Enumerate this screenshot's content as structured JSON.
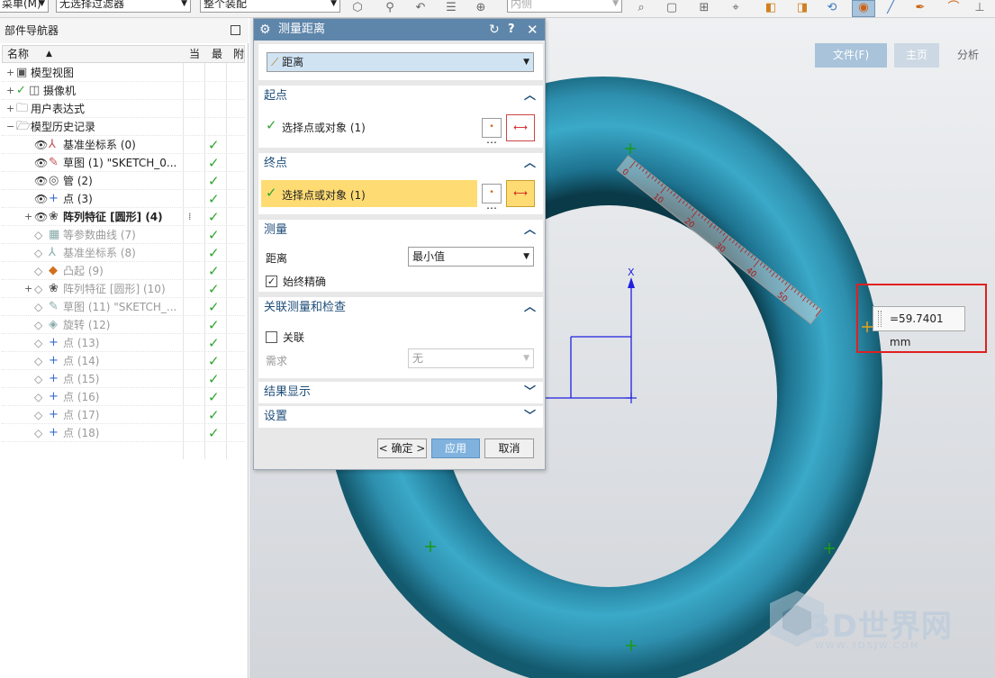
{
  "toolbar": {
    "menu_label": "菜单(M)",
    "filter_label": "无选择过滤器",
    "scope_label": "整个装配",
    "snap_label": "内侧"
  },
  "navigator": {
    "title": "部件导航器",
    "columns": {
      "name": "名称",
      "current": "当",
      "latest": "最",
      "attached": "附"
    },
    "rows": [
      {
        "label": "模型视图",
        "icon": "model-views-icon",
        "glyph": "▣",
        "expand": "+",
        "visible": false,
        "check": false,
        "dim": false,
        "bold": false,
        "indent": 0
      },
      {
        "label": "摄像机",
        "icon": "camera-icon",
        "glyph": "◫",
        "expand": "+",
        "visible": false,
        "check": false,
        "dim": false,
        "bold": false,
        "indent": 0,
        "greencheck": true
      },
      {
        "label": "用户表达式",
        "icon": "folder-icon",
        "glyph": "🗀",
        "expand": "+",
        "visible": false,
        "check": false,
        "dim": false,
        "bold": false,
        "indent": 0
      },
      {
        "label": "模型历史记录",
        "icon": "folder-open-icon",
        "glyph": "🗁",
        "expand": "−",
        "visible": false,
        "check": false,
        "dim": false,
        "bold": false,
        "indent": 0
      },
      {
        "label": "基准坐标系 (0)",
        "icon": "datum-csys-icon",
        "glyph": "⅄",
        "expand": "",
        "visible": true,
        "check": true,
        "dim": false,
        "bold": false,
        "indent": 1
      },
      {
        "label": "草图 (1) \"SKETCH_0...",
        "icon": "sketch-icon",
        "glyph": "✎",
        "expand": "",
        "visible": true,
        "check": true,
        "dim": false,
        "bold": false,
        "indent": 1
      },
      {
        "label": "管 (2)",
        "icon": "tube-icon",
        "glyph": "◎",
        "expand": "",
        "visible": true,
        "check": true,
        "dim": false,
        "bold": false,
        "indent": 1
      },
      {
        "label": "点 (3)",
        "icon": "point-icon",
        "glyph": "+",
        "expand": "",
        "visible": true,
        "check": true,
        "dim": false,
        "bold": false,
        "indent": 1
      },
      {
        "label": "阵列特征 [圆形] (4)",
        "icon": "pattern-feature-icon",
        "glyph": "❀",
        "expand": "+",
        "visible": true,
        "check": true,
        "dim": false,
        "bold": true,
        "indent": 1,
        "current": true
      },
      {
        "label": "等参数曲线 (7)",
        "icon": "iso-curve-icon",
        "glyph": "▦",
        "expand": "",
        "visible": false,
        "check": true,
        "dim": true,
        "bold": false,
        "indent": 1
      },
      {
        "label": "基准坐标系 (8)",
        "icon": "datum-csys-icon",
        "glyph": "⅄",
        "expand": "",
        "visible": false,
        "check": true,
        "dim": true,
        "bold": false,
        "indent": 1
      },
      {
        "label": "凸起 (9)",
        "icon": "emboss-icon",
        "glyph": "◆",
        "expand": "",
        "visible": false,
        "check": true,
        "dim": true,
        "bold": false,
        "indent": 1
      },
      {
        "label": "阵列特征 [圆形] (10)",
        "icon": "pattern-feature-icon",
        "glyph": "❀",
        "expand": "+",
        "visible": false,
        "check": true,
        "dim": true,
        "bold": false,
        "indent": 1
      },
      {
        "label": "草图 (11) \"SKETCH_...",
        "icon": "sketch-icon",
        "glyph": "✎",
        "expand": "",
        "visible": false,
        "check": true,
        "dim": true,
        "bold": false,
        "indent": 1
      },
      {
        "label": "旋转 (12)",
        "icon": "revolve-icon",
        "glyph": "◈",
        "expand": "",
        "visible": false,
        "check": true,
        "dim": true,
        "bold": false,
        "indent": 1
      },
      {
        "label": "点 (13)",
        "icon": "point-icon",
        "glyph": "+",
        "expand": "",
        "visible": false,
        "check": true,
        "dim": true,
        "bold": false,
        "indent": 1
      },
      {
        "label": "点 (14)",
        "icon": "point-icon",
        "glyph": "+",
        "expand": "",
        "visible": false,
        "check": true,
        "dim": true,
        "bold": false,
        "indent": 1
      },
      {
        "label": "点 (15)",
        "icon": "point-icon",
        "glyph": "+",
        "expand": "",
        "visible": false,
        "check": true,
        "dim": true,
        "bold": false,
        "indent": 1
      },
      {
        "label": "点 (16)",
        "icon": "point-icon",
        "glyph": "+",
        "expand": "",
        "visible": false,
        "check": true,
        "dim": true,
        "bold": false,
        "indent": 1
      },
      {
        "label": "点 (17)",
        "icon": "point-icon",
        "glyph": "+",
        "expand": "",
        "visible": false,
        "check": true,
        "dim": true,
        "bold": false,
        "indent": 1
      },
      {
        "label": "点 (18)",
        "icon": "point-icon",
        "glyph": "+",
        "expand": "",
        "visible": false,
        "check": true,
        "dim": true,
        "bold": false,
        "indent": 1
      }
    ]
  },
  "dialog": {
    "title": "测量距离",
    "type_value": "距离",
    "start": {
      "header": "起点",
      "select_label": "选择点或对象 (1)"
    },
    "end": {
      "header": "终点",
      "select_label": "选择点或对象 (1)"
    },
    "measure": {
      "header": "测量",
      "distance_label": "距离",
      "distance_value": "最小值",
      "precise_label": "始终精确",
      "precise_checked": true
    },
    "assoc": {
      "header": "关联测量和检查",
      "assoc_label": "关联",
      "assoc_checked": false,
      "req_label": "需求",
      "req_value": "无"
    },
    "results": {
      "header": "结果显示"
    },
    "settings": {
      "header": "设置"
    },
    "ok_label": "< 确定 >",
    "apply_label": "应用",
    "cancel_label": "取消"
  },
  "ribbon": {
    "file_tab": "文件(F)",
    "home_tab": "主页",
    "analysis_tab": "分析"
  },
  "viewport": {
    "measurement": "=59.7401 mm",
    "ruler_ticks": [
      "0",
      "10",
      "20",
      "30",
      "40",
      "50"
    ],
    "axis_label": "X",
    "watermark_main": "3D世界网",
    "watermark_sub": "WWW.3DSJW.COM"
  },
  "colors": {
    "torus": "#2f8fb0",
    "dialog_title": "#5e86aa",
    "highlight": "#ffdc73",
    "callout_border": "#e02020",
    "check_green": "#2fa52f",
    "ribbon_active": "#a8c3da"
  }
}
